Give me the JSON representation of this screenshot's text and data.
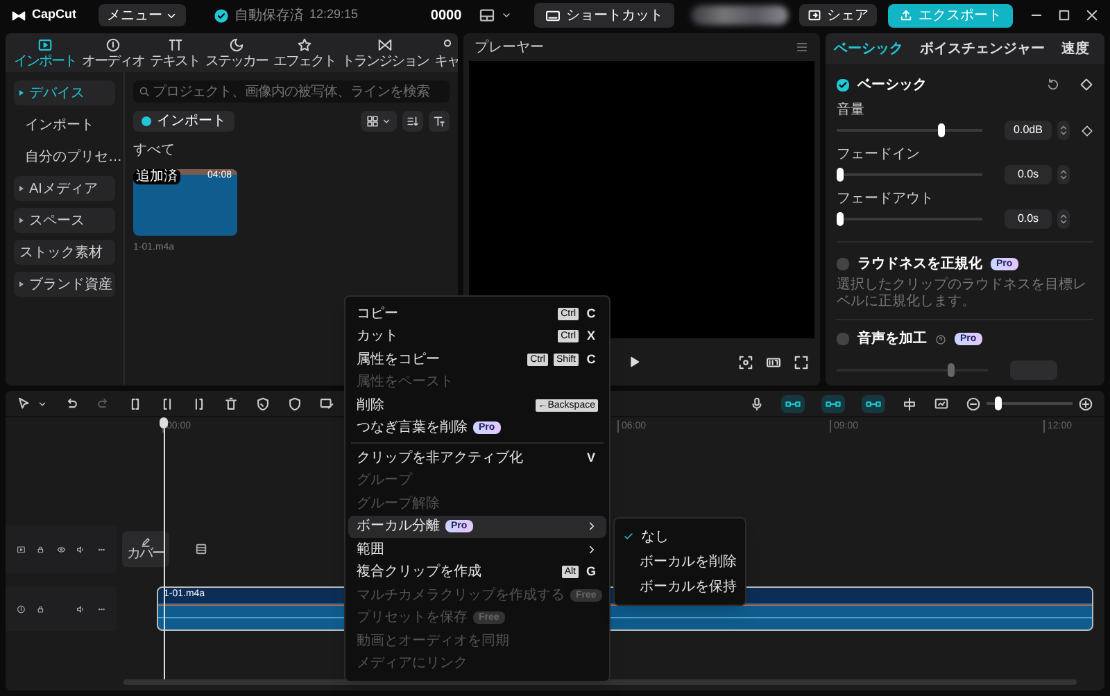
{
  "app": {
    "name": "CapCut"
  },
  "top_bar": {
    "menu_label": "メニュー",
    "autosave": "自動保存済",
    "autosave_time": "12:29:15",
    "title": "0000",
    "shortcut_button": "ショートカット",
    "share_button": "シェア",
    "export_button": "エクスポート"
  },
  "media_panel": {
    "tabs": [
      {
        "label": "インポート",
        "selected": true
      },
      {
        "label": "オーディオ",
        "selected": false
      },
      {
        "label": "テキスト",
        "selected": false
      },
      {
        "label": "ステッカー",
        "selected": false
      },
      {
        "label": "エフェクト",
        "selected": false
      },
      {
        "label": "トランジション",
        "selected": false
      },
      {
        "label": "キャ",
        "selected": false
      }
    ],
    "sidebar": [
      {
        "label": "デバイス",
        "kind": "group",
        "selected": true
      },
      {
        "label": "インポート",
        "kind": "sub",
        "selected": false
      },
      {
        "label": "自分のプリセ…",
        "kind": "sub",
        "selected": false
      },
      {
        "label": "AIメディア",
        "kind": "group",
        "selected": false
      },
      {
        "label": "スペース",
        "kind": "group",
        "selected": false
      },
      {
        "label": "ストック素材",
        "kind": "plain",
        "selected": false
      },
      {
        "label": "ブランド資産",
        "kind": "group",
        "selected": false
      }
    ],
    "search": {
      "placeholder": "プロジェクト、画像内の被写体、ラインを検索"
    },
    "import_button": "インポート",
    "filter_label": "すべて",
    "media": [
      {
        "badge": "追加済",
        "duration": "04:08",
        "name": "1-01.m4a"
      }
    ]
  },
  "player": {
    "title": "プレーヤー"
  },
  "properties": {
    "tabs": [
      {
        "label": "ベーシック",
        "selected": true
      },
      {
        "label": "ボイスチェンジャー",
        "selected": false
      },
      {
        "label": "速度",
        "selected": false
      }
    ],
    "section": {
      "title": "ベーシック",
      "checked": true
    },
    "sliders": [
      {
        "label": "音量",
        "level": 0.73,
        "reading": "0.0dB"
      },
      {
        "label": "フェードイン",
        "level": 0,
        "reading": "0.0s"
      },
      {
        "label": "フェードアウト",
        "level": 0,
        "reading": "0.0s"
      }
    ],
    "loudness": {
      "title": "ラウドネスを正規化",
      "badge": "Pro",
      "checked": false,
      "description": "選択したクリップのラウドネスを目標レベルに正規化します。"
    },
    "voice": {
      "title": "音声を加工",
      "badge": "Pro",
      "checked": false,
      "level": 0.77
    }
  },
  "timeline": {
    "zoom": {
      "level": 0.1
    },
    "ruler": [
      "00:00",
      "06:00",
      "09:00",
      "12:00"
    ],
    "cover_label": "カバー",
    "clip": {
      "name": "1-01.m4a"
    }
  },
  "context_menu": {
    "items": [
      {
        "kind": "item",
        "label": "コピー",
        "keys": [
          "Ctrl"
        ],
        "key": "C",
        "disabled": false,
        "selected": false,
        "submenu": false
      },
      {
        "kind": "item",
        "label": "カット",
        "keys": [
          "Ctrl"
        ],
        "key": "X",
        "disabled": false,
        "selected": false,
        "submenu": false
      },
      {
        "kind": "item",
        "label": "属性をコピー",
        "keys": [
          "Ctrl",
          "Shift"
        ],
        "key": "C",
        "disabled": false,
        "selected": false,
        "submenu": false
      },
      {
        "kind": "item",
        "label": "属性をペースト",
        "disabled": true,
        "selected": false,
        "submenu": false
      },
      {
        "kind": "item",
        "label": "削除",
        "keys": [
          "←Backspace"
        ],
        "disabled": false,
        "selected": false,
        "submenu": false
      },
      {
        "kind": "item",
        "label": "つなぎ言葉を削除",
        "badge": "Pro",
        "disabled": false,
        "selected": false,
        "submenu": false
      },
      {
        "kind": "separator"
      },
      {
        "kind": "item",
        "label": "クリップを非アクティブ化",
        "key": "V",
        "disabled": false,
        "selected": false,
        "submenu": false
      },
      {
        "kind": "item",
        "label": "グループ",
        "disabled": true,
        "selected": false,
        "submenu": false
      },
      {
        "kind": "item",
        "label": "グループ解除",
        "disabled": true,
        "selected": false,
        "submenu": false
      },
      {
        "kind": "item",
        "label": "ボーカル分離",
        "badge": "Pro",
        "disabled": false,
        "selected": true,
        "submenu": true
      },
      {
        "kind": "item",
        "label": "範囲",
        "disabled": false,
        "selected": false,
        "submenu": true
      },
      {
        "kind": "item",
        "label": "複合クリップを作成",
        "keys": [
          "Alt"
        ],
        "key": "G",
        "disabled": false,
        "selected": false,
        "submenu": false
      },
      {
        "kind": "item",
        "label": "マルチカメラクリップを作成する",
        "badge": "Free",
        "disabled": true,
        "selected": false,
        "submenu": false
      },
      {
        "kind": "item",
        "label": "プリセットを保存",
        "badge": "Free",
        "disabled": true,
        "selected": false,
        "submenu": false
      },
      {
        "kind": "item",
        "label": "動画とオーディオを同期",
        "disabled": true,
        "selected": false,
        "submenu": false
      },
      {
        "kind": "item",
        "label": "メディアにリンク",
        "disabled": true,
        "selected": false,
        "submenu": false
      }
    ],
    "submenu": [
      {
        "label": "なし",
        "checked": true
      },
      {
        "label": "ボーカルを削除",
        "checked": false
      },
      {
        "label": "ボーカルを保持",
        "checked": false
      }
    ]
  }
}
